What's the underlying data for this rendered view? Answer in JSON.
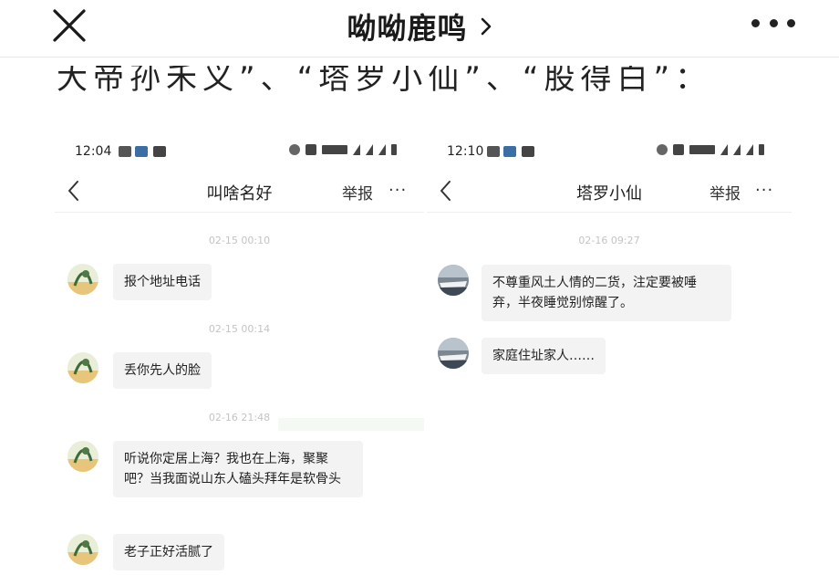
{
  "topbar": {
    "title": "呦呦鹿鸣",
    "close_icon": "close-icon",
    "more_icon": "more-dots-icon"
  },
  "article": {
    "partial_line": "大帝孙禾义”、“塔罗小仙”、“股得白”："
  },
  "left_screenshot": {
    "status_time": "12:04",
    "nav_title": "叫啥名好",
    "report_label": "举报",
    "more_label": "···",
    "messages": [
      {
        "time": "02-15 00:10",
        "text": "报个地址电话"
      },
      {
        "time": "02-15 00:14",
        "text": "丢你先人的脸"
      },
      {
        "time": "02-16 21:48",
        "text": "听说你定居上海？我也在上海，聚聚吧？当我面说山东人磕头拜年是软骨头"
      },
      {
        "time": "",
        "text": "老子正好活腻了"
      }
    ]
  },
  "right_screenshot": {
    "status_time": "12:10",
    "nav_title": "塔罗小仙",
    "report_label": "举报",
    "more_label": "···",
    "messages": [
      {
        "time": "02-16 09:27",
        "text": "不尊重风土人情的二货，注定要被唾弃，半夜睡觉别惊醒了。"
      },
      {
        "time": "",
        "text": "家庭住址家人……"
      }
    ]
  },
  "colors": {
    "bubble_bg": "#f3f3f3",
    "timestamp": "#c4c4c4",
    "title_text": "#1a1a1a"
  }
}
